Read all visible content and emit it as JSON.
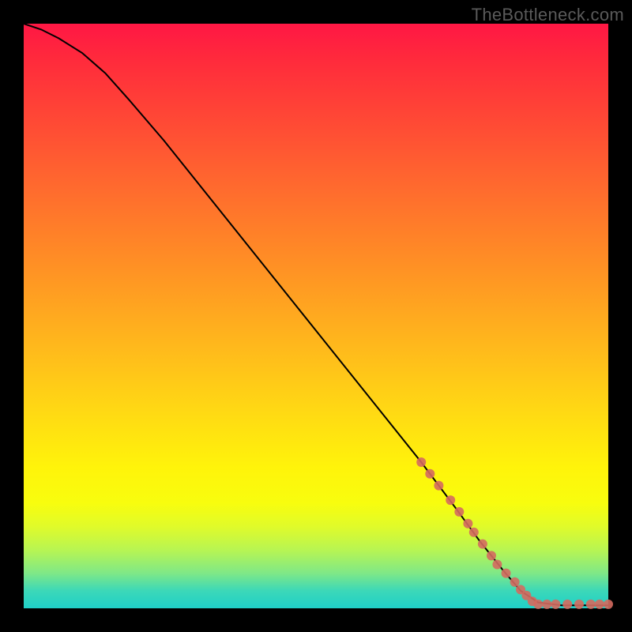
{
  "watermark": "TheBottleneck.com",
  "chart_data": {
    "type": "line",
    "title": "",
    "xlabel": "",
    "ylabel": "",
    "xlim": [
      0,
      100
    ],
    "ylim": [
      0,
      100
    ],
    "grid": false,
    "series": [
      {
        "name": "curve",
        "style": "solid",
        "x": [
          0,
          3,
          6,
          10,
          14,
          18,
          24,
          30,
          36,
          44,
          52,
          60,
          68,
          74,
          78,
          82,
          85,
          88,
          92,
          96,
          100
        ],
        "y": [
          100,
          99,
          97.5,
          95,
          91.5,
          87,
          80,
          72.5,
          65,
          55,
          45,
          35,
          25,
          17,
          11.5,
          6.5,
          3,
          1,
          0.5,
          0.5,
          0.5
        ]
      },
      {
        "name": "markers-sloped-segment",
        "style": "dots",
        "x": [
          68,
          69.5,
          71,
          73,
          74.5,
          76,
          77,
          78.5,
          80,
          81,
          82.5,
          84,
          85,
          86,
          87
        ],
        "y": [
          25,
          23,
          21,
          18.5,
          16.5,
          14.5,
          13,
          11,
          9,
          7.5,
          6,
          4.5,
          3.2,
          2.2,
          1.2
        ]
      },
      {
        "name": "markers-flat-segment",
        "style": "dots",
        "x": [
          88,
          89.5,
          91,
          93,
          95,
          97,
          98.5,
          100
        ],
        "y": [
          0.7,
          0.7,
          0.7,
          0.7,
          0.7,
          0.7,
          0.7,
          0.7
        ]
      }
    ],
    "background": {
      "type": "vertical-gradient",
      "stops": [
        {
          "pos": 0.0,
          "color": "#ff1744"
        },
        {
          "pos": 0.55,
          "color": "#ffb81c"
        },
        {
          "pos": 0.78,
          "color": "#fff40a"
        },
        {
          "pos": 0.92,
          "color": "#7fe887"
        },
        {
          "pos": 1.0,
          "color": "#1fd0c8"
        }
      ]
    }
  }
}
